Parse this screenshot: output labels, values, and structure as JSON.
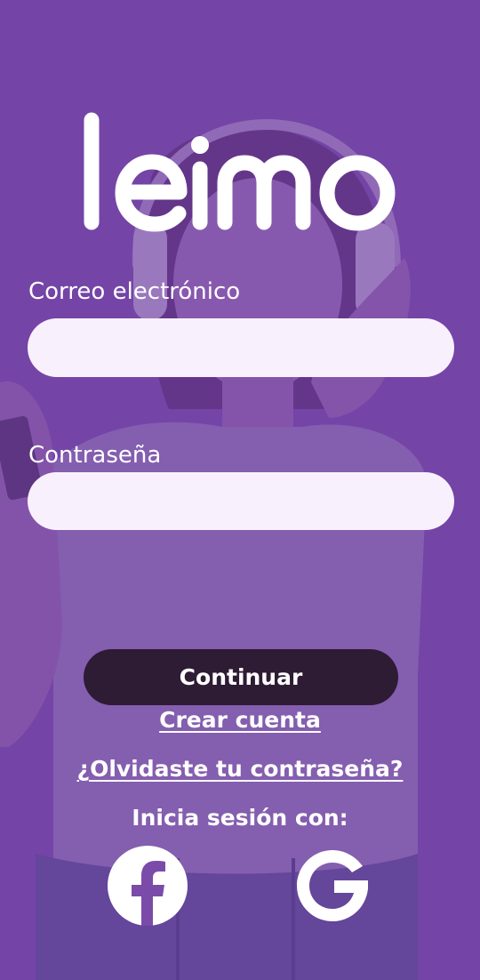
{
  "app": {
    "logo_text": "leimo",
    "colors": {
      "background": "#7a4aa8",
      "input_fill": "#f9f0fd",
      "button_fill": "#2e1b34",
      "text": "#ffffff"
    }
  },
  "form": {
    "email_label": "Correo electrónico",
    "email_value": "",
    "password_label": "Contraseña",
    "password_value": ""
  },
  "actions": {
    "continue_label": "Continuar",
    "create_account_label": "Crear cuenta",
    "forgot_password_label": "¿Olvidaste tu contraseña?"
  },
  "social": {
    "heading": "Inicia sesión con:",
    "providers": [
      {
        "icon": "facebook-icon"
      },
      {
        "icon": "google-icon"
      }
    ]
  }
}
